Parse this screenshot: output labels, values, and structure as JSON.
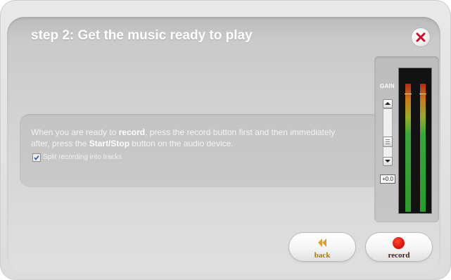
{
  "dialog": {
    "title": "step 2: Get the music ready to play",
    "close_icon": "close-x-icon"
  },
  "instruction": {
    "part1": "When you are ready to ",
    "bold1": "record",
    "part2": ", press the record button first and then immediately after, press the ",
    "bold2": "Start/Stop",
    "part3": " button on the audio device."
  },
  "options": {
    "split_tracks_label": "Split recording into tracks",
    "split_tracks_checked": true
  },
  "gain": {
    "label": "GAIN",
    "value": "+0.0",
    "up_icon": "chevron-up-icon",
    "down_icon": "chevron-down-icon"
  },
  "meters": {
    "channels": [
      "left",
      "right"
    ]
  },
  "buttons": {
    "back_label": "back",
    "back_icon": "rewind-icon",
    "record_label": "record",
    "record_icon": "record-dot-icon"
  },
  "colors": {
    "record_red": "#e01a10",
    "back_gold": "#e0a020"
  }
}
